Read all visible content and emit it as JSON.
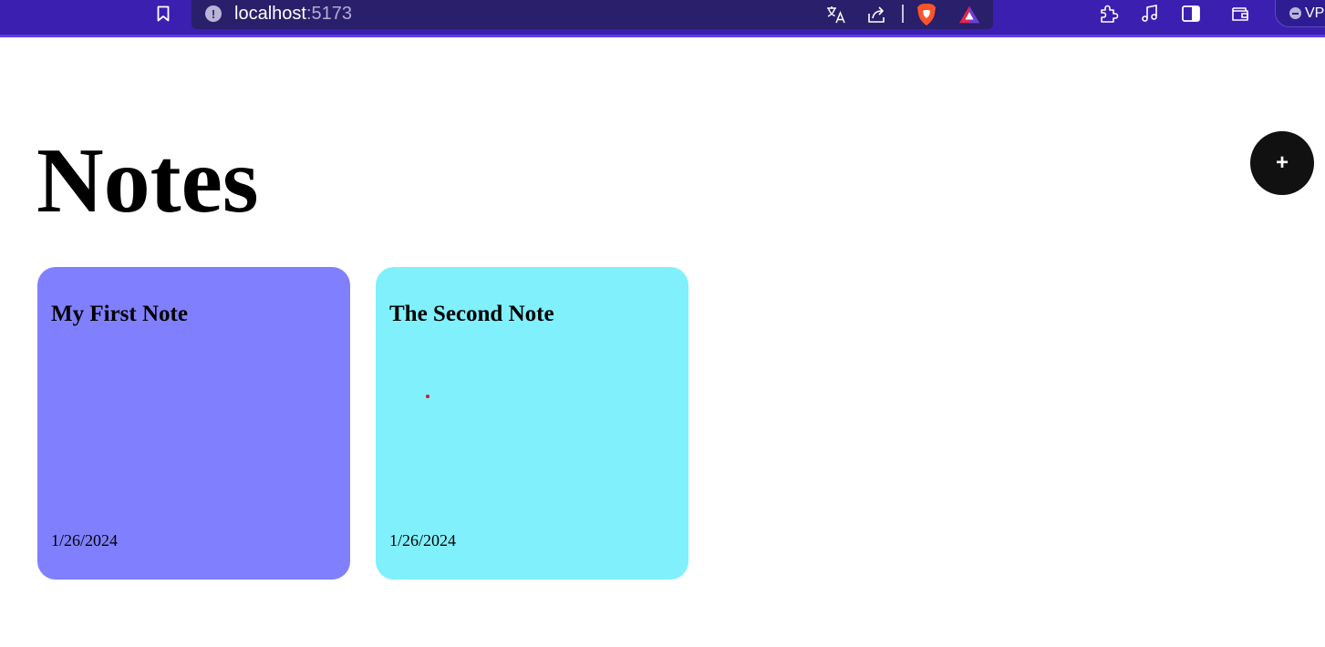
{
  "browser": {
    "url_host": "localhost",
    "url_port": ":5173",
    "vpn_label": "VPN",
    "icons": [
      "bookmark-icon",
      "site-info-icon",
      "translate-icon",
      "share-icon",
      "brave-shields-icon",
      "brave-rewards-icon",
      "extensions-icon",
      "media-icon",
      "sidebar-icon",
      "wallet-icon"
    ],
    "colors": {
      "toolbar": "#3a1fb0",
      "omnibox": "#2a1f6b"
    }
  },
  "page": {
    "title": "Notes",
    "add_button_label": "+"
  },
  "notes": [
    {
      "title": "My First Note",
      "date": "1/26/2024",
      "color": "#8080ff"
    },
    {
      "title": "The Second Note",
      "date": "1/26/2024",
      "color": "#80f0fc"
    }
  ]
}
